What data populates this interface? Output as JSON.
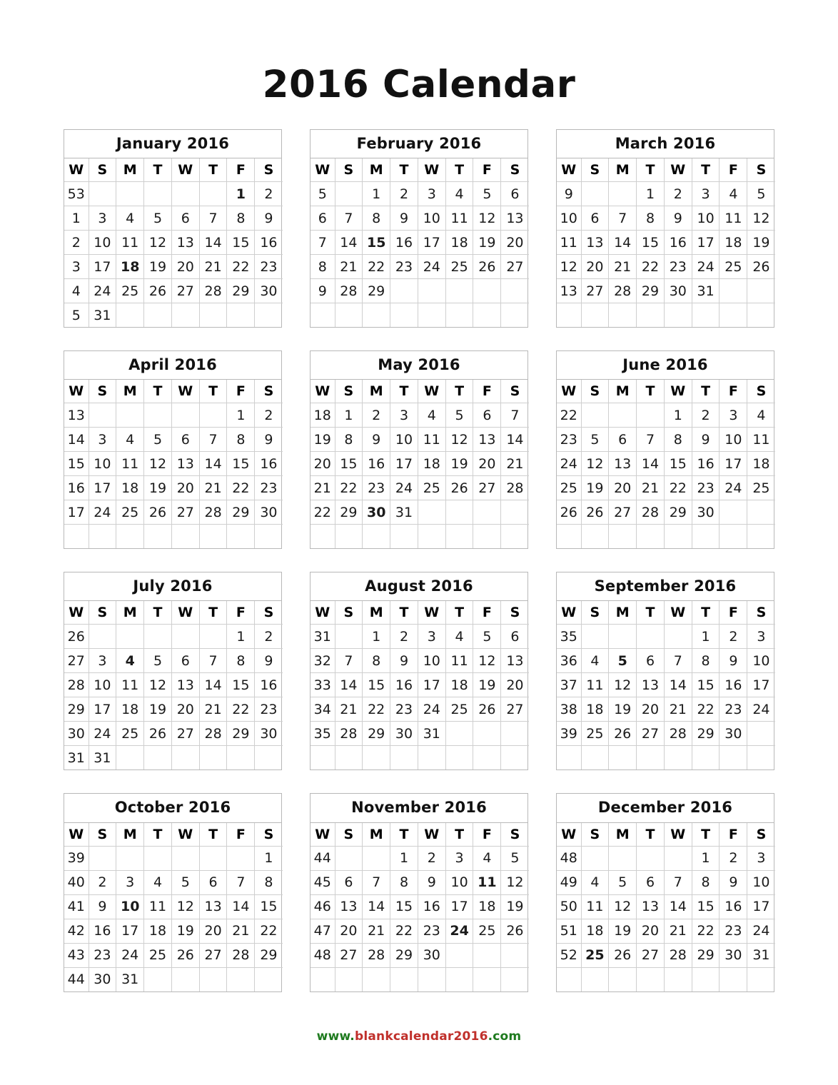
{
  "page": {
    "title": "2016 Calendar",
    "year": 2016
  },
  "colors": {
    "week_number": "#3f8c3f",
    "holiday": "#c0302b",
    "text": "#1a1a1a",
    "border": "#cfcfcf",
    "block_border": "#b8b8b8",
    "footer_green": "#1e7a1e",
    "footer_red": "#c0302b"
  },
  "day_headers": [
    "W",
    "S",
    "M",
    "T",
    "W",
    "T",
    "F",
    "S"
  ],
  "footer": {
    "prefix": "www.",
    "domain": "blankcalendar2016",
    "suffix": ".com",
    "full": "www.blankcalendar2016.com"
  },
  "months": [
    {
      "name": "January 2016",
      "month": 1,
      "weeks": [
        {
          "wk": "53",
          "days": [
            "",
            "",
            "",
            "",
            "",
            "1",
            "2"
          ],
          "holidays": [
            5
          ]
        },
        {
          "wk": "1",
          "days": [
            "3",
            "4",
            "5",
            "6",
            "7",
            "8",
            "9"
          ],
          "holidays": []
        },
        {
          "wk": "2",
          "days": [
            "10",
            "11",
            "12",
            "13",
            "14",
            "15",
            "16"
          ],
          "holidays": []
        },
        {
          "wk": "3",
          "days": [
            "17",
            "18",
            "19",
            "20",
            "21",
            "22",
            "23"
          ],
          "holidays": [
            1
          ]
        },
        {
          "wk": "4",
          "days": [
            "24",
            "25",
            "26",
            "27",
            "28",
            "29",
            "30"
          ],
          "holidays": []
        },
        {
          "wk": "5",
          "days": [
            "31",
            "",
            "",
            "",
            "",
            "",
            ""
          ],
          "holidays": []
        }
      ]
    },
    {
      "name": "February 2016",
      "month": 2,
      "weeks": [
        {
          "wk": "5",
          "days": [
            "",
            "1",
            "2",
            "3",
            "4",
            "5",
            "6"
          ],
          "holidays": []
        },
        {
          "wk": "6",
          "days": [
            "7",
            "8",
            "9",
            "10",
            "11",
            "12",
            "13"
          ],
          "holidays": []
        },
        {
          "wk": "7",
          "days": [
            "14",
            "15",
            "16",
            "17",
            "18",
            "19",
            "20"
          ],
          "holidays": [
            1
          ]
        },
        {
          "wk": "8",
          "days": [
            "21",
            "22",
            "23",
            "24",
            "25",
            "26",
            "27"
          ],
          "holidays": []
        },
        {
          "wk": "9",
          "days": [
            "28",
            "29",
            "",
            "",
            "",
            "",
            ""
          ],
          "holidays": []
        },
        {
          "wk": "",
          "days": [
            "",
            "",
            "",
            "",
            "",
            "",
            ""
          ],
          "holidays": []
        }
      ]
    },
    {
      "name": "March 2016",
      "month": 3,
      "weeks": [
        {
          "wk": "9",
          "days": [
            "",
            "",
            "1",
            "2",
            "3",
            "4",
            "5"
          ],
          "holidays": []
        },
        {
          "wk": "10",
          "days": [
            "6",
            "7",
            "8",
            "9",
            "10",
            "11",
            "12"
          ],
          "holidays": []
        },
        {
          "wk": "11",
          "days": [
            "13",
            "14",
            "15",
            "16",
            "17",
            "18",
            "19"
          ],
          "holidays": []
        },
        {
          "wk": "12",
          "days": [
            "20",
            "21",
            "22",
            "23",
            "24",
            "25",
            "26"
          ],
          "holidays": []
        },
        {
          "wk": "13",
          "days": [
            "27",
            "28",
            "29",
            "30",
            "31",
            "",
            ""
          ],
          "holidays": []
        },
        {
          "wk": "",
          "days": [
            "",
            "",
            "",
            "",
            "",
            "",
            ""
          ],
          "holidays": []
        }
      ]
    },
    {
      "name": "April 2016",
      "month": 4,
      "weeks": [
        {
          "wk": "13",
          "days": [
            "",
            "",
            "",
            "",
            "",
            "1",
            "2"
          ],
          "holidays": []
        },
        {
          "wk": "14",
          "days": [
            "3",
            "4",
            "5",
            "6",
            "7",
            "8",
            "9"
          ],
          "holidays": []
        },
        {
          "wk": "15",
          "days": [
            "10",
            "11",
            "12",
            "13",
            "14",
            "15",
            "16"
          ],
          "holidays": []
        },
        {
          "wk": "16",
          "days": [
            "17",
            "18",
            "19",
            "20",
            "21",
            "22",
            "23"
          ],
          "holidays": []
        },
        {
          "wk": "17",
          "days": [
            "24",
            "25",
            "26",
            "27",
            "28",
            "29",
            "30"
          ],
          "holidays": []
        },
        {
          "wk": "",
          "days": [
            "",
            "",
            "",
            "",
            "",
            "",
            ""
          ],
          "holidays": []
        }
      ]
    },
    {
      "name": "May 2016",
      "month": 5,
      "weeks": [
        {
          "wk": "18",
          "days": [
            "1",
            "2",
            "3",
            "4",
            "5",
            "6",
            "7"
          ],
          "holidays": []
        },
        {
          "wk": "19",
          "days": [
            "8",
            "9",
            "10",
            "11",
            "12",
            "13",
            "14"
          ],
          "holidays": []
        },
        {
          "wk": "20",
          "days": [
            "15",
            "16",
            "17",
            "18",
            "19",
            "20",
            "21"
          ],
          "holidays": []
        },
        {
          "wk": "21",
          "days": [
            "22",
            "23",
            "24",
            "25",
            "26",
            "27",
            "28"
          ],
          "holidays": []
        },
        {
          "wk": "22",
          "days": [
            "29",
            "30",
            "31",
            "",
            "",
            "",
            ""
          ],
          "holidays": [
            1
          ]
        },
        {
          "wk": "",
          "days": [
            "",
            "",
            "",
            "",
            "",
            "",
            ""
          ],
          "holidays": []
        }
      ]
    },
    {
      "name": "June 2016",
      "month": 6,
      "weeks": [
        {
          "wk": "22",
          "days": [
            "",
            "",
            "",
            "1",
            "2",
            "3",
            "4"
          ],
          "holidays": []
        },
        {
          "wk": "23",
          "days": [
            "5",
            "6",
            "7",
            "8",
            "9",
            "10",
            "11"
          ],
          "holidays": []
        },
        {
          "wk": "24",
          "days": [
            "12",
            "13",
            "14",
            "15",
            "16",
            "17",
            "18"
          ],
          "holidays": []
        },
        {
          "wk": "25",
          "days": [
            "19",
            "20",
            "21",
            "22",
            "23",
            "24",
            "25"
          ],
          "holidays": []
        },
        {
          "wk": "26",
          "days": [
            "26",
            "27",
            "28",
            "29",
            "30",
            "",
            ""
          ],
          "holidays": []
        },
        {
          "wk": "",
          "days": [
            "",
            "",
            "",
            "",
            "",
            "",
            ""
          ],
          "holidays": []
        }
      ]
    },
    {
      "name": "July 2016",
      "month": 7,
      "weeks": [
        {
          "wk": "26",
          "days": [
            "",
            "",
            "",
            "",
            "",
            "1",
            "2"
          ],
          "holidays": []
        },
        {
          "wk": "27",
          "days": [
            "3",
            "4",
            "5",
            "6",
            "7",
            "8",
            "9"
          ],
          "holidays": [
            1
          ]
        },
        {
          "wk": "28",
          "days": [
            "10",
            "11",
            "12",
            "13",
            "14",
            "15",
            "16"
          ],
          "holidays": []
        },
        {
          "wk": "29",
          "days": [
            "17",
            "18",
            "19",
            "20",
            "21",
            "22",
            "23"
          ],
          "holidays": []
        },
        {
          "wk": "30",
          "days": [
            "24",
            "25",
            "26",
            "27",
            "28",
            "29",
            "30"
          ],
          "holidays": []
        },
        {
          "wk": "31",
          "days": [
            "31",
            "",
            "",
            "",
            "",
            "",
            ""
          ],
          "holidays": []
        }
      ]
    },
    {
      "name": "August 2016",
      "month": 8,
      "weeks": [
        {
          "wk": "31",
          "days": [
            "",
            "1",
            "2",
            "3",
            "4",
            "5",
            "6"
          ],
          "holidays": []
        },
        {
          "wk": "32",
          "days": [
            "7",
            "8",
            "9",
            "10",
            "11",
            "12",
            "13"
          ],
          "holidays": []
        },
        {
          "wk": "33",
          "days": [
            "14",
            "15",
            "16",
            "17",
            "18",
            "19",
            "20"
          ],
          "holidays": []
        },
        {
          "wk": "34",
          "days": [
            "21",
            "22",
            "23",
            "24",
            "25",
            "26",
            "27"
          ],
          "holidays": []
        },
        {
          "wk": "35",
          "days": [
            "28",
            "29",
            "30",
            "31",
            "",
            "",
            ""
          ],
          "holidays": []
        },
        {
          "wk": "",
          "days": [
            "",
            "",
            "",
            "",
            "",
            "",
            ""
          ],
          "holidays": []
        }
      ]
    },
    {
      "name": "September 2016",
      "month": 9,
      "weeks": [
        {
          "wk": "35",
          "days": [
            "",
            "",
            "",
            "",
            "1",
            "2",
            "3"
          ],
          "holidays": []
        },
        {
          "wk": "36",
          "days": [
            "4",
            "5",
            "6",
            "7",
            "8",
            "9",
            "10"
          ],
          "holidays": [
            1
          ]
        },
        {
          "wk": "37",
          "days": [
            "11",
            "12",
            "13",
            "14",
            "15",
            "16",
            "17"
          ],
          "holidays": []
        },
        {
          "wk": "38",
          "days": [
            "18",
            "19",
            "20",
            "21",
            "22",
            "23",
            "24"
          ],
          "holidays": []
        },
        {
          "wk": "39",
          "days": [
            "25",
            "26",
            "27",
            "28",
            "29",
            "30",
            ""
          ],
          "holidays": []
        },
        {
          "wk": "",
          "days": [
            "",
            "",
            "",
            "",
            "",
            "",
            ""
          ],
          "holidays": []
        }
      ]
    },
    {
      "name": "October 2016",
      "month": 10,
      "weeks": [
        {
          "wk": "39",
          "days": [
            "",
            "",
            "",
            "",
            "",
            "",
            "1"
          ],
          "holidays": []
        },
        {
          "wk": "40",
          "days": [
            "2",
            "3",
            "4",
            "5",
            "6",
            "7",
            "8"
          ],
          "holidays": []
        },
        {
          "wk": "41",
          "days": [
            "9",
            "10",
            "11",
            "12",
            "13",
            "14",
            "15"
          ],
          "holidays": [
            1
          ]
        },
        {
          "wk": "42",
          "days": [
            "16",
            "17",
            "18",
            "19",
            "20",
            "21",
            "22"
          ],
          "holidays": []
        },
        {
          "wk": "43",
          "days": [
            "23",
            "24",
            "25",
            "26",
            "27",
            "28",
            "29"
          ],
          "holidays": []
        },
        {
          "wk": "44",
          "days": [
            "30",
            "31",
            "",
            "",
            "",
            "",
            ""
          ],
          "holidays": []
        }
      ]
    },
    {
      "name": "November 2016",
      "month": 11,
      "weeks": [
        {
          "wk": "44",
          "days": [
            "",
            "",
            "1",
            "2",
            "3",
            "4",
            "5"
          ],
          "holidays": []
        },
        {
          "wk": "45",
          "days": [
            "6",
            "7",
            "8",
            "9",
            "10",
            "11",
            "12"
          ],
          "holidays": [
            5
          ]
        },
        {
          "wk": "46",
          "days": [
            "13",
            "14",
            "15",
            "16",
            "17",
            "18",
            "19"
          ],
          "holidays": []
        },
        {
          "wk": "47",
          "days": [
            "20",
            "21",
            "22",
            "23",
            "24",
            "25",
            "26"
          ],
          "holidays": [
            4
          ]
        },
        {
          "wk": "48",
          "days": [
            "27",
            "28",
            "29",
            "30",
            "",
            "",
            ""
          ],
          "holidays": []
        },
        {
          "wk": "",
          "days": [
            "",
            "",
            "",
            "",
            "",
            "",
            ""
          ],
          "holidays": []
        }
      ]
    },
    {
      "name": "December 2016",
      "month": 12,
      "weeks": [
        {
          "wk": "48",
          "days": [
            "",
            "",
            "",
            "",
            "1",
            "2",
            "3"
          ],
          "holidays": []
        },
        {
          "wk": "49",
          "days": [
            "4",
            "5",
            "6",
            "7",
            "8",
            "9",
            "10"
          ],
          "holidays": []
        },
        {
          "wk": "50",
          "days": [
            "11",
            "12",
            "13",
            "14",
            "15",
            "16",
            "17"
          ],
          "holidays": []
        },
        {
          "wk": "51",
          "days": [
            "18",
            "19",
            "20",
            "21",
            "22",
            "23",
            "24"
          ],
          "holidays": []
        },
        {
          "wk": "52",
          "days": [
            "25",
            "26",
            "27",
            "28",
            "29",
            "30",
            "31"
          ],
          "holidays": [
            0
          ]
        },
        {
          "wk": "",
          "days": [
            "",
            "",
            "",
            "",
            "",
            "",
            ""
          ],
          "holidays": []
        }
      ]
    }
  ]
}
